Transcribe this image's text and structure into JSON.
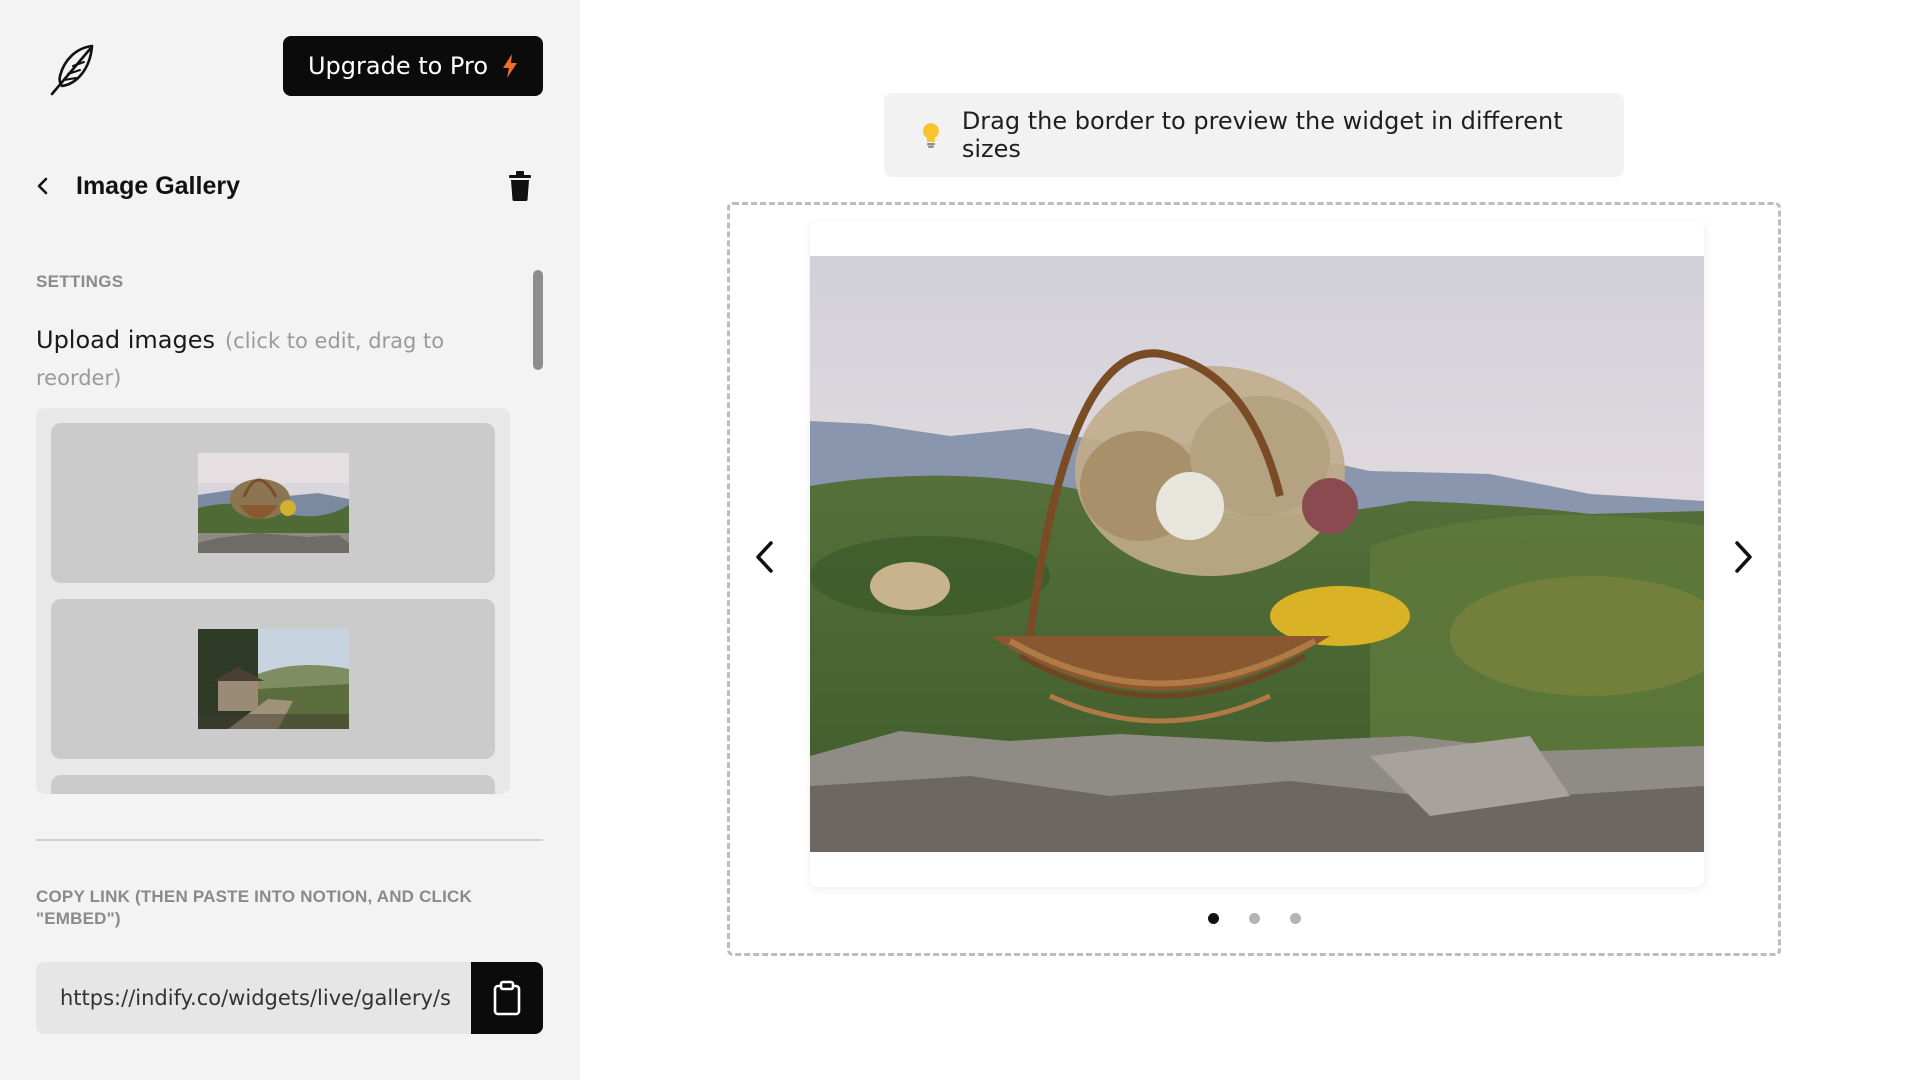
{
  "header": {
    "upgrade_label": "Upgrade to Pro",
    "accent_color": "#f26b2a"
  },
  "editor": {
    "title": "Image Gallery",
    "settings_label": "SETTINGS",
    "upload_label": "Upload images",
    "upload_hint": "(click to edit, drag to reorder)",
    "images": [
      {
        "name": "flower-basket-on-rock"
      },
      {
        "name": "country-road-with-stone-house"
      },
      {
        "name": "third-image"
      }
    ]
  },
  "share": {
    "copy_label": "COPY LINK (THEN PASTE INTO NOTION, AND CLICK \"EMBED\")",
    "link_value": "https://indify.co/widgets/live/gallery/s"
  },
  "preview": {
    "tip_text": "Drag the border to preview the widget in different sizes",
    "active_slide": 1,
    "slide_count": 3
  }
}
